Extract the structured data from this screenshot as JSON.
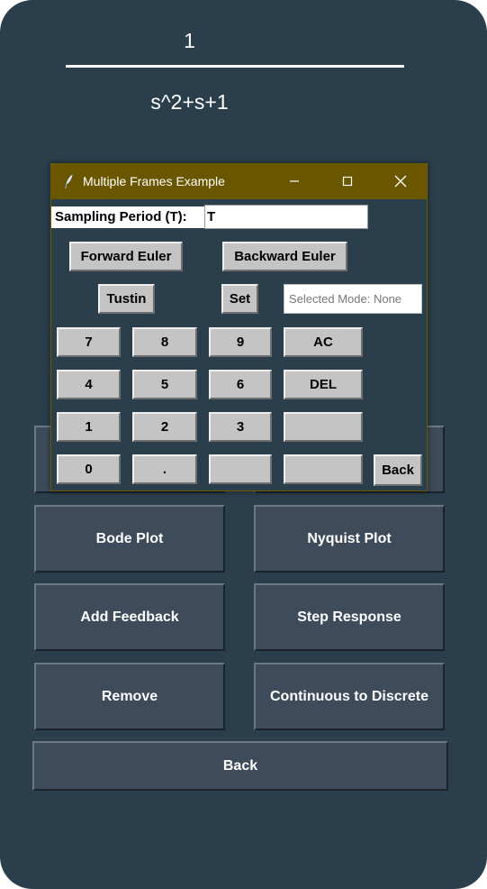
{
  "transfer_function": {
    "numerator": "1",
    "denominator": "s^2+s+1"
  },
  "main_buttons": {
    "bode": "Bode Plot",
    "nyquist": "Nyquist Plot",
    "add_feedback": "Add Feedback",
    "step_response": "Step Response",
    "remove": "Remove",
    "c2d": "Continuous to Discrete",
    "back": "Back"
  },
  "dialog": {
    "title": "Multiple Frames Example",
    "sampling_label": "Sampling Period (T):",
    "sampling_value": "T",
    "forward_euler": "Forward Euler",
    "backward_euler": "Backward Euler",
    "tustin": "Tustin",
    "set": "Set",
    "selected_mode": "Selected Mode: None",
    "keys": [
      "7",
      "8",
      "9",
      "AC",
      "4",
      "5",
      "6",
      "DEL",
      "1",
      "2",
      "3",
      "",
      "0",
      ".",
      "",
      ""
    ],
    "back": "Back"
  }
}
